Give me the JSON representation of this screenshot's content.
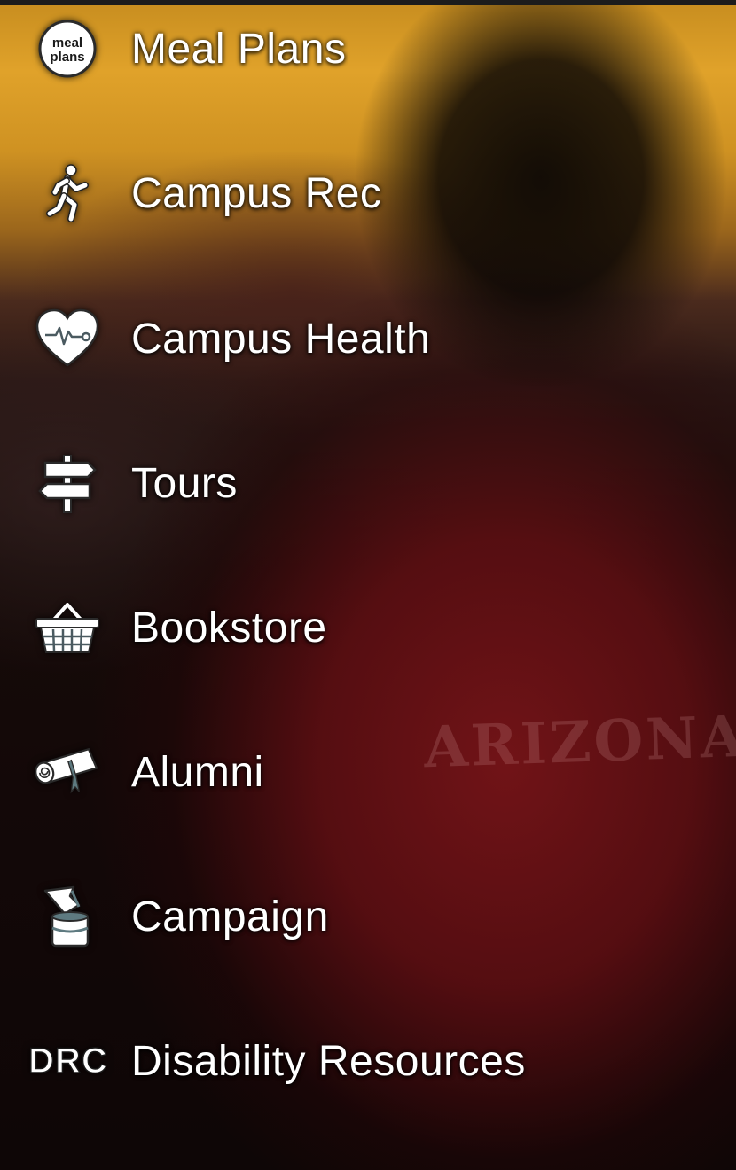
{
  "menu": {
    "items": [
      {
        "label": "Meal Plans",
        "icon": "meal-plans-icon",
        "icon_text_top": "meal",
        "icon_text_bottom": "plans"
      },
      {
        "label": "Campus Rec",
        "icon": "running-person-icon"
      },
      {
        "label": "Campus Health",
        "icon": "heart-pulse-icon"
      },
      {
        "label": "Tours",
        "icon": "signpost-icon"
      },
      {
        "label": "Bookstore",
        "icon": "basket-icon"
      },
      {
        "label": "Alumni",
        "icon": "diploma-icon"
      },
      {
        "label": "Campaign",
        "icon": "paint-can-icon"
      },
      {
        "label": "Disability Resources",
        "icon": "drc-icon",
        "icon_text": "DRC"
      }
    ]
  },
  "background": {
    "watermark_text": "ARIZONA"
  }
}
